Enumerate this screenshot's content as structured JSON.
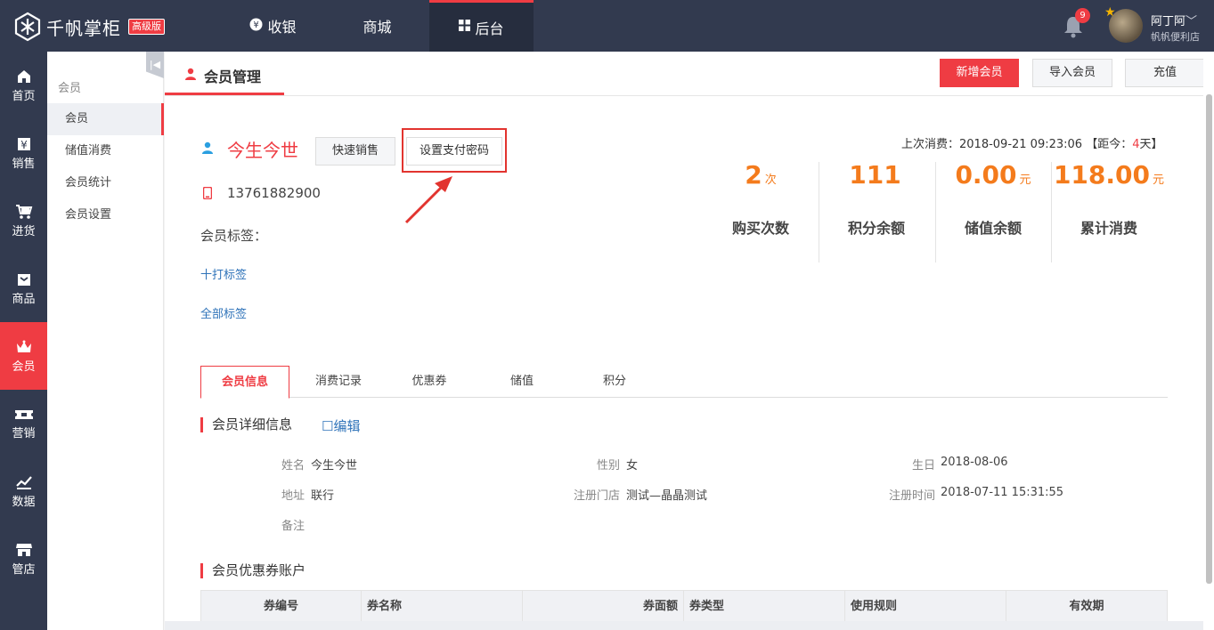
{
  "brand": {
    "name": "千帆掌柜",
    "edition": "高级版"
  },
  "topnav": [
    {
      "label": "收银",
      "glyph": "¥"
    },
    {
      "label": "商城",
      "glyph": ""
    },
    {
      "label": "后台",
      "glyph": "▦"
    }
  ],
  "notifications": {
    "count": "9"
  },
  "user": {
    "name": "阿丁阿",
    "shop": "帆帆便利店"
  },
  "leftnav": [
    {
      "label": "首页",
      "icon": "home-icon"
    },
    {
      "label": "销售",
      "icon": "receipt-icon"
    },
    {
      "label": "进货",
      "icon": "cart-icon"
    },
    {
      "label": "商品",
      "icon": "box-icon"
    },
    {
      "label": "会员",
      "icon": "crown-icon"
    },
    {
      "label": "营销",
      "icon": "ticket-icon"
    },
    {
      "label": "数据",
      "icon": "chart-icon"
    },
    {
      "label": "管店",
      "icon": "store-icon"
    }
  ],
  "subnav": {
    "title": "会员",
    "items": [
      "会员",
      "储值消费",
      "会员统计",
      "会员设置"
    ]
  },
  "page": {
    "title": "会员管理",
    "actions": {
      "add": "新增会员",
      "import": "导入会员",
      "recharge": "充值"
    }
  },
  "member": {
    "name": "今生今世",
    "phone": "13761882900",
    "quick_sale": "快速销售",
    "set_password": "设置支付密码",
    "tags_label": "会员标签：",
    "add_tag": "十打标签",
    "all_tags": "全部标签",
    "last_consume_prefix": "上次消费：2018-09-21 09:23:06 【距今：",
    "last_consume_days": "4",
    "last_consume_suffix": "天】"
  },
  "stats": [
    {
      "value": "2",
      "unit": "次",
      "label": "购买次数"
    },
    {
      "value": "111",
      "unit": "",
      "label": "积分余额"
    },
    {
      "value": "0.00",
      "unit": "元",
      "label": "储值余额"
    },
    {
      "value": "118.00",
      "unit": "元",
      "label": "累计消费"
    }
  ],
  "tabs": [
    "会员信息",
    "消费记录",
    "优惠券",
    "储值",
    "积分"
  ],
  "detail": {
    "title": "会员详细信息",
    "edit": "编辑",
    "fields": {
      "name_label": "姓名",
      "name": "今生今世",
      "gender_label": "性别",
      "gender": "女",
      "birthday_label": "生日",
      "birthday": "2018-08-06",
      "address_label": "地址",
      "address": "联行",
      "store_label": "注册门店",
      "store": "测试—晶晶测试",
      "regtime_label": "注册时间",
      "regtime": "2018-07-11 15:31:55",
      "note_label": "备注",
      "note": ""
    }
  },
  "coupon": {
    "title": "会员优惠券账户",
    "columns": [
      "券编号",
      "券名称",
      "券面额",
      "券类型",
      "使用规则",
      "有效期"
    ]
  },
  "colors": {
    "accent": "#ef3c43",
    "nav": "#323a4f",
    "stat": "#f47b1c",
    "link": "#2f73b9"
  }
}
